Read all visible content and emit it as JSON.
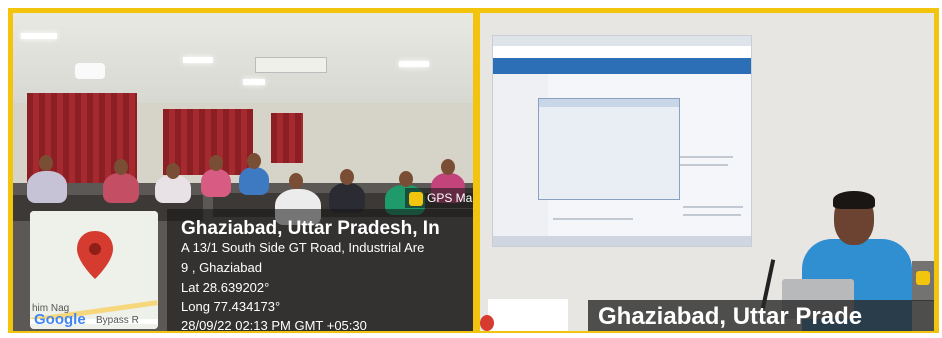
{
  "left_photo": {
    "gps_badge": "GPS Ma",
    "location_title": "Ghaziabad, Uttar Pradesh, In",
    "address_line1": "A 13/1 South Side GT Road, Industrial Are",
    "address_line2": "9 , Ghaziabad",
    "lat": "Lat 28.639202°",
    "long": "Long 77.434173°",
    "timestamp": "28/09/22 02:13 PM GMT +05:30",
    "map_label_road": "Bypass R",
    "map_label_area": "him Nag",
    "map_logo": "Google"
  },
  "right_photo": {
    "location_title": "Ghaziabad, Uttar Prade"
  },
  "colors": {
    "frame": "#f2c40d",
    "map_pin": "#d63b2f"
  }
}
